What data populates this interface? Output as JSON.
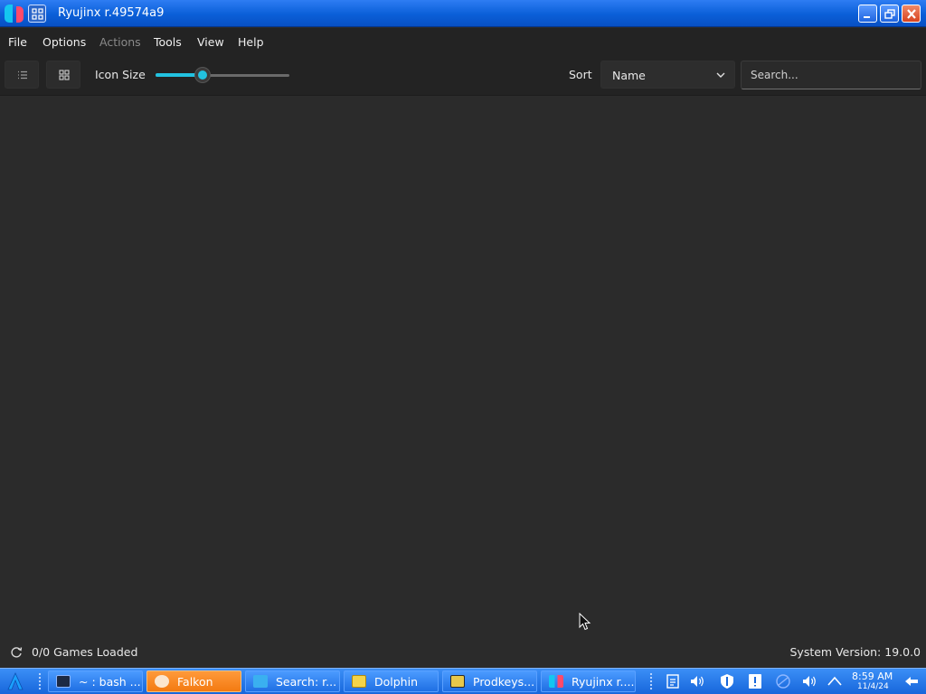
{
  "window": {
    "title": "Ryujinx r.49574a9"
  },
  "menu": {
    "items": [
      "File",
      "Options",
      "Actions",
      "Tools",
      "View",
      "Help"
    ]
  },
  "toolbar": {
    "icon_size_label": "Icon Size",
    "icon_size_value": 0.35,
    "sort_label": "Sort",
    "sort_value": "Name",
    "search_placeholder": "Search..."
  },
  "status": {
    "games_loaded": "0/0 Games Loaded",
    "system_version": "System Version: 19.0.0"
  },
  "taskbar": {
    "tasks": [
      {
        "label": "~ : bash ...",
        "icon": "terminal-icon"
      },
      {
        "label": "Falkon",
        "icon": "falkon-icon"
      },
      {
        "label": "Search: r...",
        "icon": "search-window-icon"
      },
      {
        "label": "Dolphin",
        "icon": "folder-icon"
      },
      {
        "label": "Prodkeys...",
        "icon": "archive-icon"
      },
      {
        "label": "Ryujinx r....",
        "icon": "ryujinx-icon"
      }
    ],
    "clock_time": "8:59 AM",
    "clock_date": "11/4/24"
  },
  "colors": {
    "titlebar": "#0a5fd8",
    "background": "#2b2b2b",
    "accent": "#22c2e0",
    "active_task": "#f37a12"
  }
}
